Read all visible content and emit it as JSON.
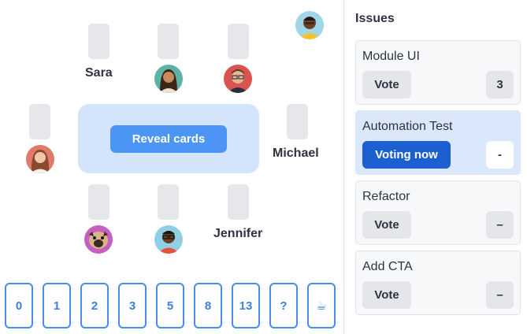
{
  "players": {
    "sara": {
      "name": "Sara"
    },
    "michael": {
      "name": "Michael"
    },
    "jennifer": {
      "name": "Jennifer"
    }
  },
  "table": {
    "reveal_label": "Reveal cards"
  },
  "deck": [
    "0",
    "1",
    "2",
    "3",
    "5",
    "8",
    "13",
    "?",
    "☕"
  ],
  "sidebar": {
    "title": "Issues",
    "issues": [
      {
        "title": "Module UI",
        "button": "Vote",
        "score": "3",
        "active": false
      },
      {
        "title": "Automation Test",
        "button": "Voting now",
        "score": "-",
        "active": true
      },
      {
        "title": "Refactor",
        "button": "Vote",
        "score": "–",
        "active": false
      },
      {
        "title": "Add CTA",
        "button": "Vote",
        "score": "–",
        "active": false
      }
    ]
  },
  "colors": {
    "accent": "#4d95f5",
    "voting_now": "#1c5fd1",
    "table": "#d3e4fb",
    "active_issue": "#dbe8fb"
  }
}
